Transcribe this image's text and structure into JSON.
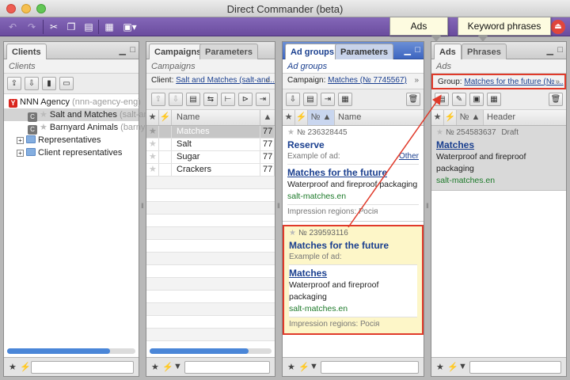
{
  "window": {
    "title": "Direct Commander (beta)"
  },
  "toolbar": {
    "buttons": [
      "undo-icon",
      "redo-icon",
      "cut-icon",
      "copy-icon",
      "paste-icon",
      "table-icon",
      "view-icon"
    ]
  },
  "callouts": {
    "ads": "Ads",
    "keyword_phrases": "Keyword phrases"
  },
  "clients_panel": {
    "tab": "Clients",
    "subtitle": "Clients",
    "tree": {
      "agency": "NNN Agency",
      "agency_login": "(nnn-agency-eng)",
      "client1": "Salt and Matches",
      "client1_login": "(salt-and-",
      "client2": "Barnyard Animals",
      "client2_login": "(barnyar",
      "folder1": "Representatives",
      "folder2": "Client representatives"
    }
  },
  "campaigns_panel": {
    "tabs": [
      "Campaigns",
      "Parameters"
    ],
    "subtitle": "Campaigns",
    "filter_label": "Client:",
    "filter_value": "Salt and Matches (salt-and...",
    "column_name": "Name",
    "rows": [
      {
        "name": "Matches",
        "id": "77"
      },
      {
        "name": "Salt",
        "id": "77"
      },
      {
        "name": "Sugar",
        "id": "77"
      },
      {
        "name": "Crackers",
        "id": "77"
      }
    ]
  },
  "adgroups_panel": {
    "tabs": [
      "Ad groups",
      "Parameters"
    ],
    "subtitle": "Ad groups",
    "filter_label": "Campaign:",
    "filter_value": "Matches (№ 7745567)",
    "col_num": "№",
    "col_name": "Name",
    "groups": [
      {
        "num": "№ 236328445",
        "name": "Reserve",
        "example_label": "Example of ad:",
        "other": "Other"
      },
      {
        "ad_title": "Matches for the future",
        "ad_text": "Waterproof and fireproof packaging",
        "ad_url": "salt-matches.en",
        "regions": "Impression regions: Росія"
      },
      {
        "num": "№ 239593116",
        "name": "Matches for the future",
        "example_label": "Example of ad:",
        "ad_title": "Matches",
        "ad_text": "Waterproof and fireproof packaging",
        "ad_url": "salt-matches.en",
        "regions": "Impression regions: Росія"
      }
    ]
  },
  "ads_panel": {
    "tabs": [
      "Ads",
      "Phrases"
    ],
    "subtitle": "Ads",
    "filter_label": "Group:",
    "filter_value": "Matches for the future (№ ...",
    "col_num": "№",
    "col_header": "Header",
    "ad": {
      "num": "№ 254583637",
      "status": "Draft",
      "title": "Matches",
      "text": "Waterproof and fireproof packaging",
      "url": "salt-matches.en"
    }
  }
}
